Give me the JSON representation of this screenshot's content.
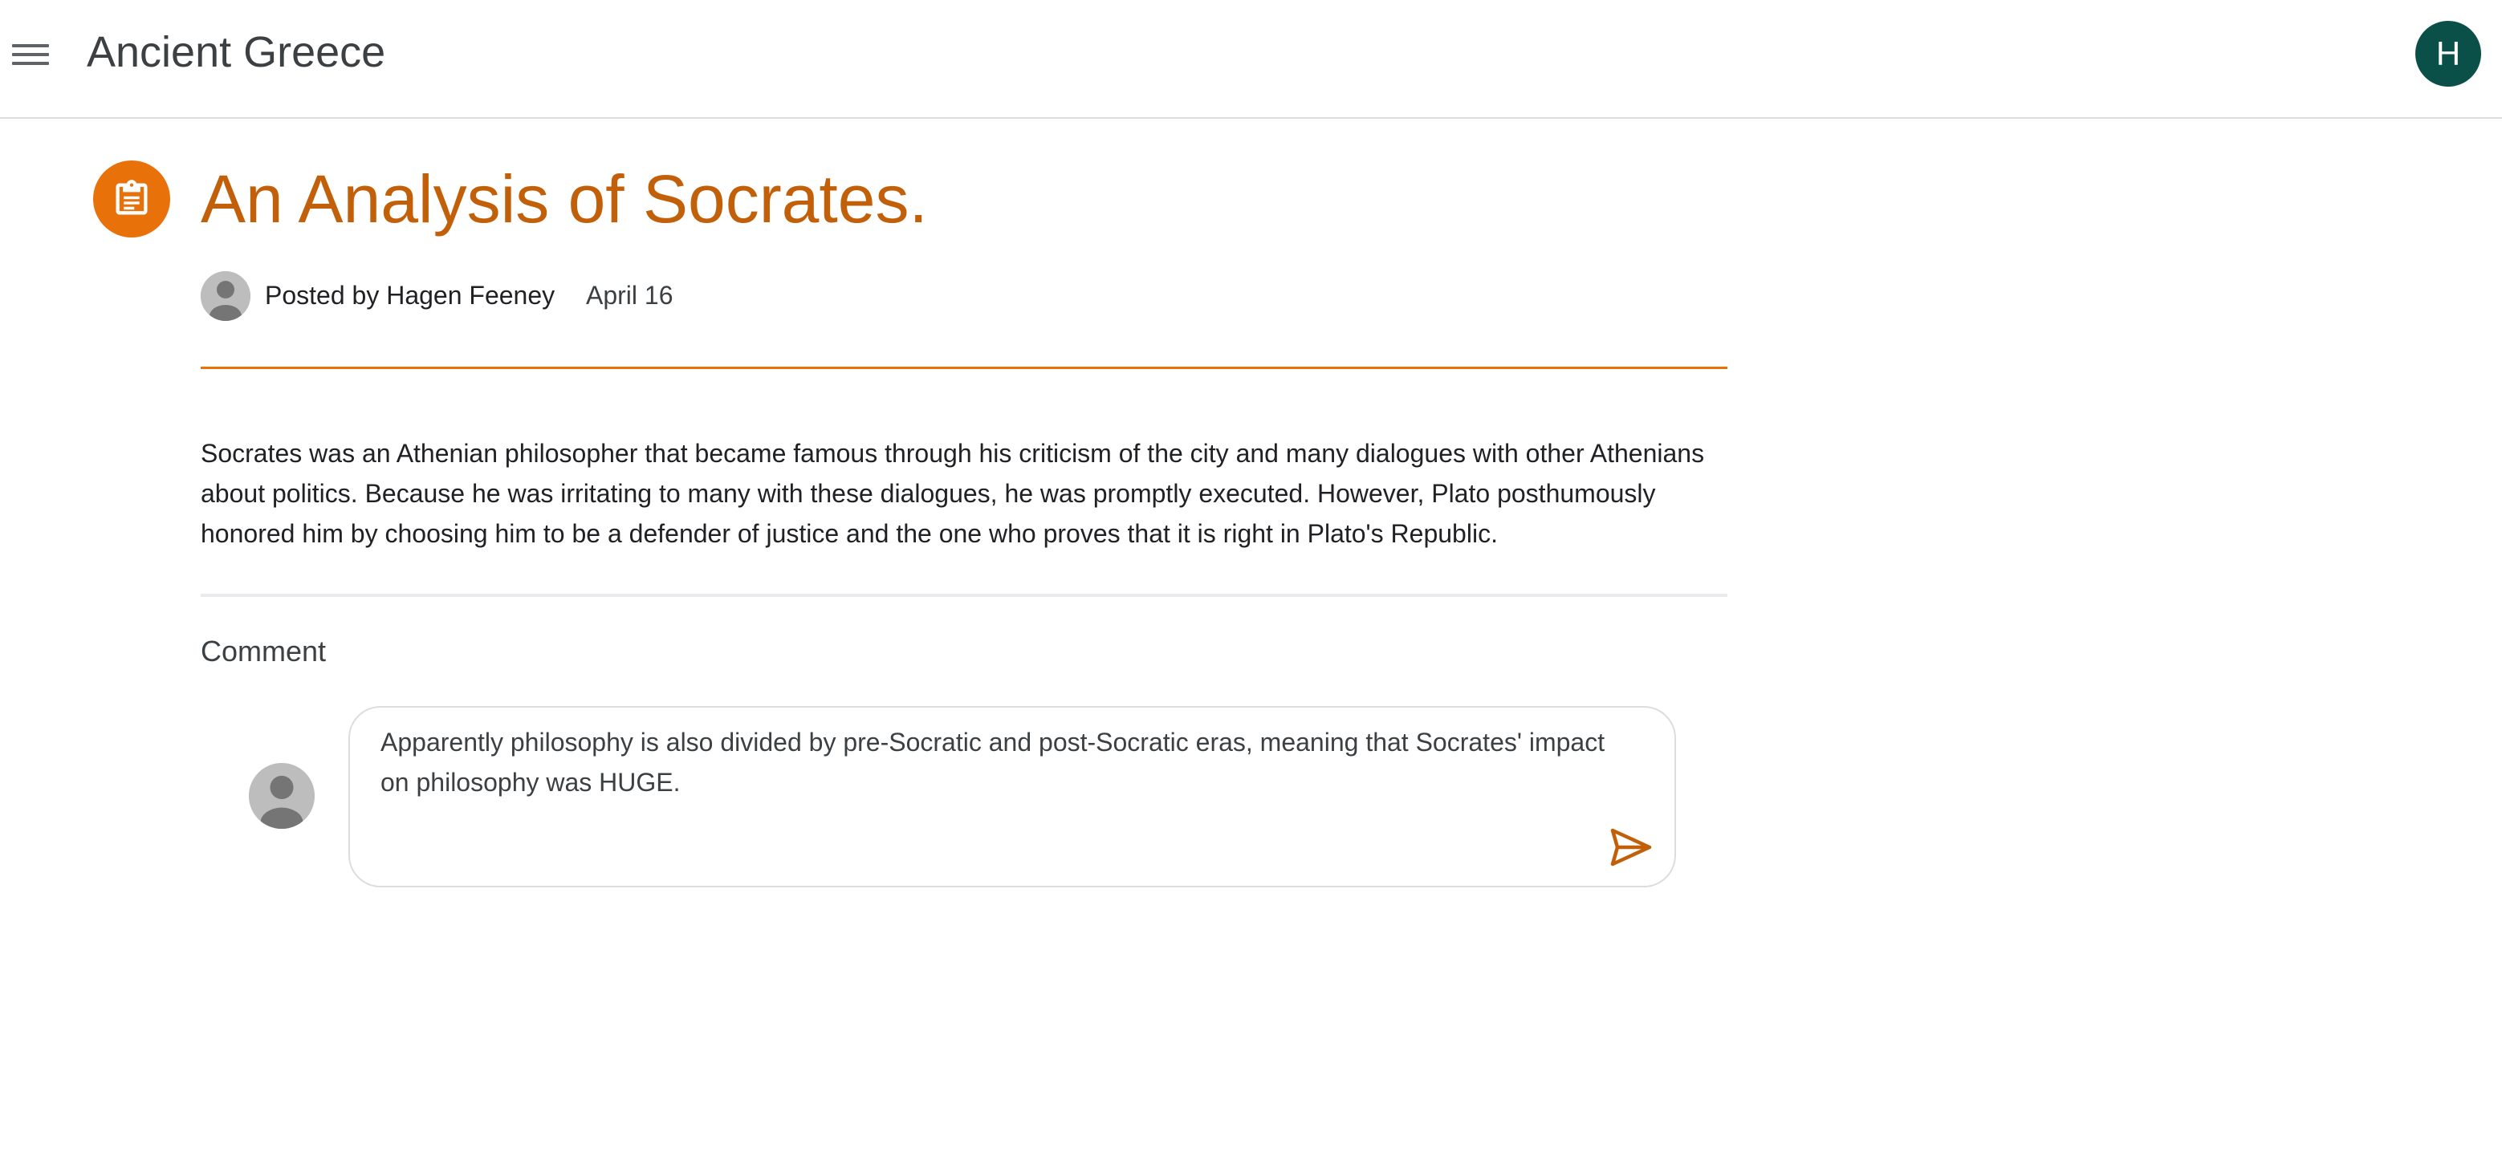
{
  "header": {
    "menu_icon": "hamburger-menu-icon",
    "class_title": "Ancient Greece",
    "user_avatar_initial": "H",
    "user_avatar_color": "#0b5048"
  },
  "post": {
    "icon": "assignment-clipboard-icon",
    "icon_color": "#e8710a",
    "title": "An Analysis of Socrates.",
    "title_color": "#c2600a",
    "author_line": "Posted by Hagen Feeney",
    "date": "April 16",
    "body": "Socrates was an Athenian philosopher that became famous through his criticism of the city and many dialogues with other Athenians about politics. Because he was irritating to many with these dialogues, he was promptly executed. However, Plato posthumously honored him by choosing him to be a defender of justice and the one who proves that it is right in Plato's Republic."
  },
  "comments": {
    "label": "Comment",
    "input_value": "Apparently philosophy is also divided by pre-Socratic and post-Socratic eras, meaning that Socrates' impact on philosophy was HUGE.",
    "send_icon": "send-icon",
    "accent_color": "#c2600a"
  }
}
